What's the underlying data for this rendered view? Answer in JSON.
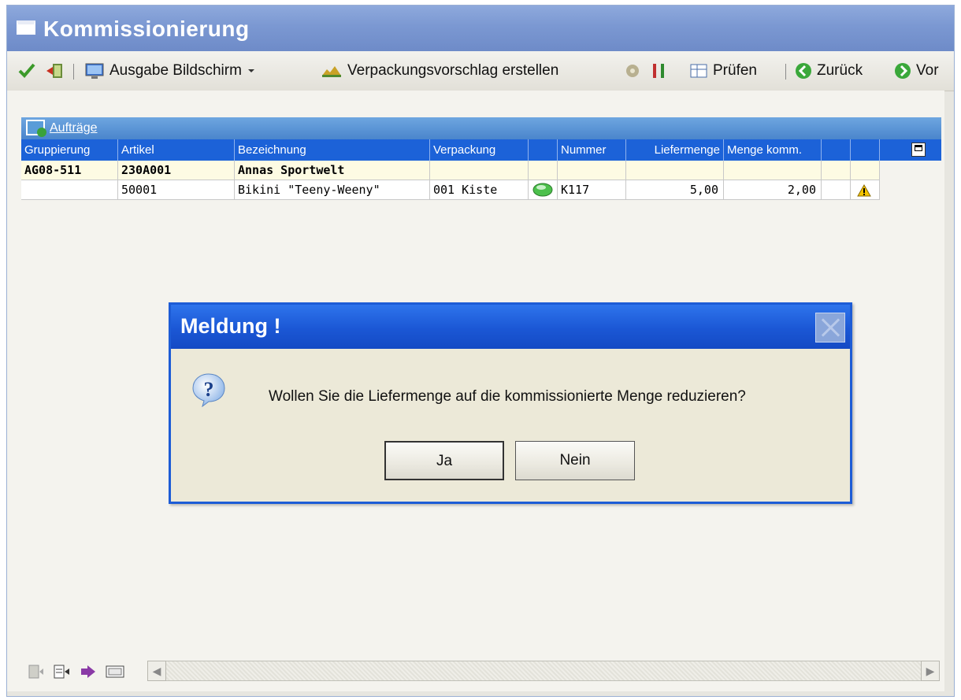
{
  "window": {
    "title": "Kommissionierung"
  },
  "toolbar": {
    "items": [
      {
        "label": "Ausgabe Bildschirm",
        "icon": "monitor-icon",
        "has_dropdown": true
      },
      {
        "label": "Verpackungsvorschlag erstellen",
        "icon": "packaging-icon"
      },
      {
        "label": "Prüfen",
        "icon": "check-table-icon"
      },
      {
        "label": "Zurück",
        "icon": "arrow-left-circle-icon",
        "accel": "Z"
      },
      {
        "label": "Vor",
        "icon": "arrow-right-circle-icon",
        "accel": "V"
      }
    ]
  },
  "panel": {
    "title": "Aufträge",
    "columns": [
      "Gruppierung",
      "Artikel",
      "Bezeichnung",
      "Verpackung",
      "",
      "Nummer",
      "Liefermenge",
      "Menge komm.",
      "",
      ""
    ],
    "rows": [
      {
        "gruppierung": "AG08-511",
        "artikel": "230A001",
        "bezeichnung": "Annas Sportwelt",
        "verpackung": "",
        "nummer": "",
        "liefermenge": "",
        "menge_komm": "",
        "is_group": true
      },
      {
        "gruppierung": "",
        "artikel": "50001",
        "bezeichnung": "Bikini \"Teeny-Weeny\"",
        "verpackung": "001  Kiste",
        "nummer": "K117",
        "liefermenge": "5,00",
        "menge_komm": "2,00",
        "status_icon": "green-status-icon",
        "warning_icon": "warning-icon"
      }
    ]
  },
  "dialog": {
    "title": "Meldung !",
    "message": "Wollen Sie die Liefermenge auf die kommissionierte Menge reduzieren?",
    "buttons": {
      "yes": "Ja",
      "no": "Nein"
    },
    "icon": "question-icon"
  },
  "colors": {
    "title_bar": "#7b98d2",
    "grid_header": "#1c62d8",
    "group_row": "#fdfbe3",
    "dialog_title": "#1b57d5"
  }
}
